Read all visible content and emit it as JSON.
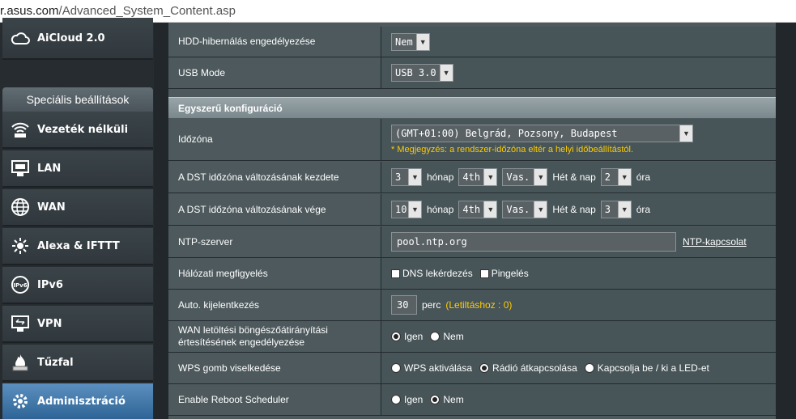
{
  "browser": {
    "url_prefix": "r.asus.com",
    "url_path": "/Advanced_System_Content.asp"
  },
  "sidebar": {
    "top_item": "AiCloud 2.0",
    "section_title": "Speciális beállítások",
    "items": [
      {
        "label": "Vezeték nélküli",
        "icon": "wireless-icon"
      },
      {
        "label": "LAN",
        "icon": "lan-icon"
      },
      {
        "label": "WAN",
        "icon": "globe-icon"
      },
      {
        "label": "Alexa & IFTTT",
        "icon": "alexa-icon"
      },
      {
        "label": "IPv6",
        "icon": "ipv6-icon"
      },
      {
        "label": "VPN",
        "icon": "vpn-icon"
      },
      {
        "label": "Tűzfal",
        "icon": "firewall-icon"
      },
      {
        "label": "Adminisztráció",
        "icon": "gear-icon"
      }
    ],
    "active": "Adminisztráció"
  },
  "usb": {
    "hdd_label": "HDD-hibernálás engedélyezése",
    "hdd_value": "Nem",
    "usb_mode_label": "USB Mode",
    "usb_mode_value": "USB 3.0"
  },
  "basic": {
    "section_title": "Egyszerű konfiguráció",
    "timezone_label": "Időzóna",
    "timezone_value": "(GMT+01:00) Belgrád, Pozsony, Budapest",
    "timezone_note": "* Megjegyzés: a rendszer-időzóna eltér a helyi időbeállítástól.",
    "dst_start_label": "A DST időzóna változásának kezdete",
    "dst_start": {
      "month": "3",
      "week": "4th",
      "day": "Vas.",
      "hour": "2"
    },
    "dst_end_label": "A DST időzóna változásának vége",
    "dst_end": {
      "month": "10",
      "week": "4th",
      "day": "Vas.",
      "hour": "3"
    },
    "month_text": "hónap",
    "weekday_text": "Hét & nap",
    "hour_text": "óra",
    "ntp_label": "NTP-szerver",
    "ntp_value": "pool.ntp.org",
    "ntp_link": "NTP-kapcsolat",
    "netmon_label": "Hálózati megfigyelés",
    "netmon_dns": "DNS lekérdezés",
    "netmon_ping": "Pingelés",
    "logout_label": "Auto. kijelentkezés",
    "logout_value": "30",
    "logout_unit": "perc",
    "logout_hint": "(Letiltáshoz : 0)",
    "wan_redirect_label": "WAN letöltési böngészőátirányítási értesítésének engedélyezése",
    "wan_redirect_yes": "Igen",
    "wan_redirect_no": "Nem",
    "wan_redirect_selected": "Igen",
    "wps_label": "WPS gomb viselkedése",
    "wps_opt1": "WPS aktiválása",
    "wps_opt2": "Rádió átkapcsolása",
    "wps_opt3": "Kapcsolja be / ki a LED-et",
    "wps_selected": "Rádió átkapcsolása",
    "reboot_label": "Enable Reboot Scheduler",
    "reboot_yes": "Igen",
    "reboot_no": "Nem",
    "reboot_selected": "Nem"
  }
}
